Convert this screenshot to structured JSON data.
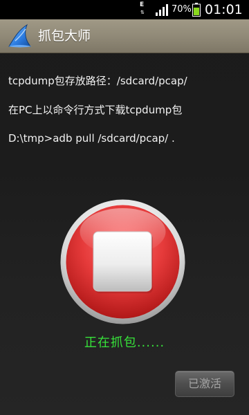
{
  "status_bar": {
    "network_type": "E",
    "network_arrows": "⇅",
    "battery_percent": "70%",
    "time": "01:01"
  },
  "app_bar": {
    "title": "抓包大师",
    "icon": "shark-fin-icon"
  },
  "info": {
    "line1": "tcpdump包存放路径：/sdcard/pcap/",
    "line2": "在PC上以命令行方式下载tcpdump包",
    "line3": "D:\\tmp>adb pull /sdcard/pcap/ ."
  },
  "stop_button": {
    "icon": "stop-icon"
  },
  "capture_status": "正在抓包......",
  "activate_button": {
    "label": "已激活"
  },
  "colors": {
    "status_text": "#37e23a",
    "app_bar": "#8f8876",
    "stop_red": "#e53a3a",
    "battery_green": "#8ad81e"
  }
}
